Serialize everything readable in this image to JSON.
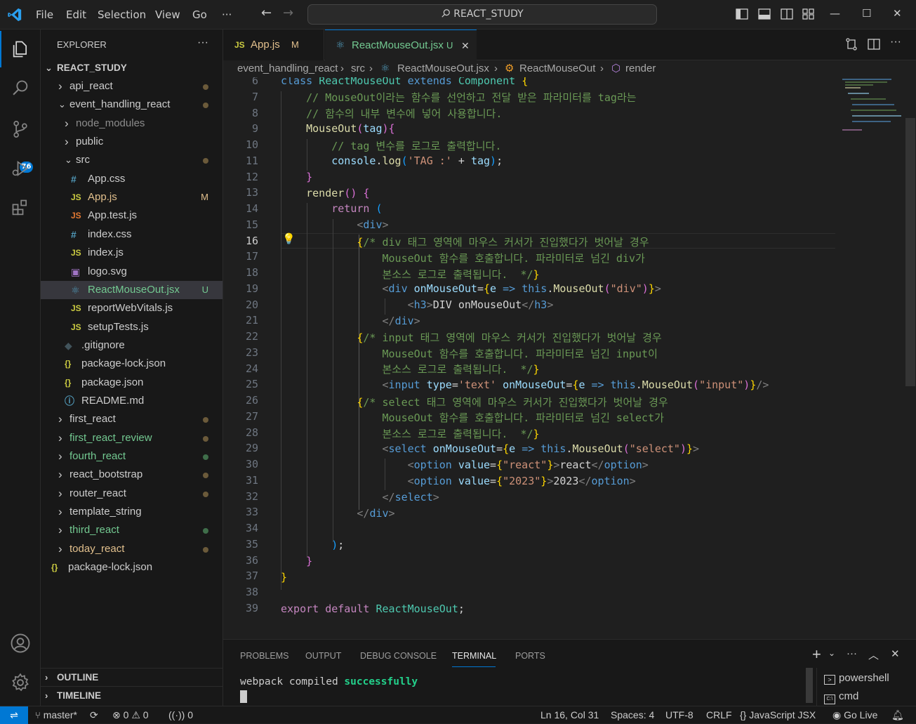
{
  "menu": [
    "File",
    "Edit",
    "Selection",
    "View",
    "Go",
    "···"
  ],
  "command_center": "REACT_STUDY",
  "activity": {
    "scm_badge": "76"
  },
  "explorer": {
    "title": "EXPLORER",
    "more": "···",
    "root": "REACT_STUDY",
    "items": [
      {
        "label": "api_react",
        "type": "folder",
        "open": false,
        "color": "#cccccc",
        "dot": "#6b5a3a"
      },
      {
        "label": "event_handling_react",
        "type": "folder",
        "open": true,
        "color": "#cccccc",
        "dot": "#6b5a3a"
      },
      {
        "label": "node_modules",
        "type": "folder",
        "open": false,
        "color": "#8c8c8c"
      },
      {
        "label": "public",
        "type": "folder",
        "open": false,
        "color": "#cccccc"
      },
      {
        "label": "src",
        "type": "folder",
        "open": true,
        "color": "#cccccc",
        "dot": "#6b5a3a"
      },
      {
        "label": "App.css",
        "type": "file",
        "icon": "#",
        "iconColor": "#519aba",
        "color": "#cccccc"
      },
      {
        "label": "App.js",
        "type": "file",
        "icon": "JS",
        "iconColor": "#cbcb41",
        "color": "#e2c08d",
        "dec": "M",
        "decColor": "#e2c08d"
      },
      {
        "label": "App.test.js",
        "type": "file",
        "icon": "JS",
        "iconColor": "#e37933",
        "color": "#cccccc"
      },
      {
        "label": "index.css",
        "type": "file",
        "icon": "#",
        "iconColor": "#519aba",
        "color": "#cccccc"
      },
      {
        "label": "index.js",
        "type": "file",
        "icon": "JS",
        "iconColor": "#cbcb41",
        "color": "#cccccc"
      },
      {
        "label": "logo.svg",
        "type": "file",
        "icon": "▣",
        "iconColor": "#a074c4",
        "color": "#cccccc"
      },
      {
        "label": "ReactMouseOut.jsx",
        "type": "file",
        "icon": "⚛",
        "iconColor": "#519aba",
        "color": "#73c991",
        "dec": "U",
        "decColor": "#73c991"
      },
      {
        "label": "reportWebVitals.js",
        "type": "file",
        "icon": "JS",
        "iconColor": "#cbcb41",
        "color": "#cccccc"
      },
      {
        "label": "setupTests.js",
        "type": "file",
        "icon": "JS",
        "iconColor": "#cbcb41",
        "color": "#cccccc"
      },
      {
        "label": ".gitignore",
        "type": "file",
        "icon": "◆",
        "iconColor": "#41535b",
        "color": "#cccccc"
      },
      {
        "label": "package-lock.json",
        "type": "file",
        "icon": "{}",
        "iconColor": "#cbcb41",
        "color": "#cccccc"
      },
      {
        "label": "package.json",
        "type": "file",
        "icon": "{}",
        "iconColor": "#cbcb41",
        "color": "#cccccc"
      },
      {
        "label": "README.md",
        "type": "file",
        "icon": "ⓘ",
        "iconColor": "#519aba",
        "color": "#cccccc"
      },
      {
        "label": "first_react",
        "type": "folder",
        "open": false,
        "color": "#cccccc",
        "dot": "#6b5a3a"
      },
      {
        "label": "first_react_review",
        "type": "folder",
        "open": false,
        "color": "#73c991",
        "dot": "#6b5a3a"
      },
      {
        "label": "fourth_react",
        "type": "folder",
        "open": false,
        "color": "#73c991",
        "dot": "#3f6e4a"
      },
      {
        "label": "react_bootstrap",
        "type": "folder",
        "open": false,
        "color": "#cccccc",
        "dot": "#6b5a3a"
      },
      {
        "label": "router_react",
        "type": "folder",
        "open": false,
        "color": "#cccccc",
        "dot": "#6b5a3a"
      },
      {
        "label": "template_string",
        "type": "folder",
        "open": false,
        "color": "#cccccc"
      },
      {
        "label": "third_react",
        "type": "folder",
        "open": false,
        "color": "#73c991",
        "dot": "#3f6e4a"
      },
      {
        "label": "today_react",
        "type": "folder",
        "open": false,
        "color": "#e2c08d",
        "dot": "#6b5a3a"
      },
      {
        "label": "package-lock.json",
        "type": "file",
        "icon": "{}",
        "iconColor": "#cbcb41",
        "color": "#cccccc"
      }
    ],
    "outline": "OUTLINE",
    "timeline": "TIMELINE"
  },
  "tabs": [
    {
      "label": "App.js",
      "icon": "JS",
      "dec": "M",
      "active": false
    },
    {
      "label": "ReactMouseOut.jsx",
      "icon": "⚛",
      "dec": "U",
      "active": true
    }
  ],
  "breadcrumb": [
    "event_handling_react",
    "src",
    "ReactMouseOut.jsx",
    "ReactMouseOut",
    "render"
  ],
  "editor": {
    "line_numbers": [
      "6",
      "7",
      "8",
      "9",
      "10",
      "11",
      "12",
      "13",
      "14",
      "15",
      "16",
      "17",
      "18",
      "19",
      "20",
      "21",
      "22",
      "23",
      "24",
      "25",
      "26",
      "27",
      "28",
      "29",
      "30",
      "31",
      "32",
      "33",
      "34",
      "35",
      "36",
      "37",
      "38",
      "39"
    ],
    "current_line": "16"
  },
  "panel": {
    "tabs": [
      "PROBLEMS",
      "OUTPUT",
      "DEBUG CONSOLE",
      "TERMINAL",
      "PORTS"
    ],
    "active_tab": "TERMINAL",
    "terminal_text": "webpack compiled ",
    "terminal_success": "successfully",
    "terminals": [
      "powershell",
      "cmd"
    ]
  },
  "status": {
    "branch": "master*",
    "errors": "0",
    "warnings": "0",
    "ports": "0",
    "position": "Ln 16, Col 31",
    "spaces": "Spaces: 4",
    "encoding": "UTF-8",
    "eol": "CRLF",
    "language": "JavaScript JSX",
    "live": "Go Live"
  }
}
